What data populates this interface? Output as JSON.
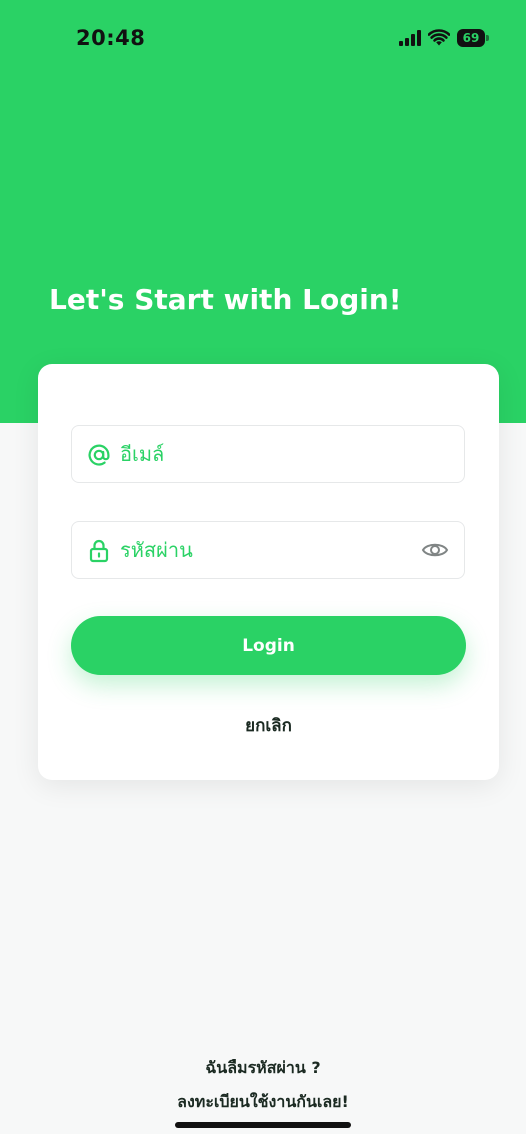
{
  "status_bar": {
    "time": "20:48",
    "battery_level": "69",
    "icons": [
      "signal-icon",
      "wifi-icon",
      "battery-icon"
    ]
  },
  "hero": {
    "title": "Let's Start with Login!"
  },
  "form": {
    "email_placeholder": "อีเมล์",
    "email_icon": "at-icon",
    "password_placeholder": "รหัสผ่าน",
    "password_icon": "lock-icon",
    "visibility_icon": "eye-icon",
    "login_label": "Login",
    "cancel_label": "ยกเลิก"
  },
  "footer": {
    "forgot_label": "ฉันลืมรหัสผ่าน ?",
    "register_label": "ลงทะเบียนใช้งานกันเลย!"
  },
  "colors": {
    "accent": "#2ad265",
    "background": "#f7f8f8",
    "card": "#ffffff",
    "text_dark": "#1b2a22"
  }
}
